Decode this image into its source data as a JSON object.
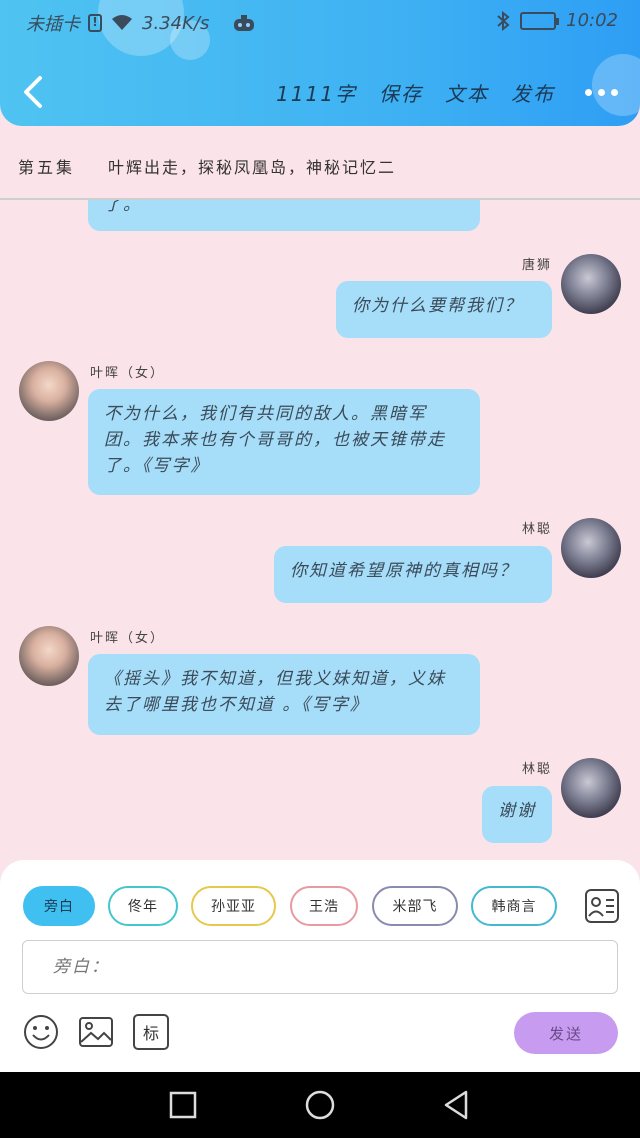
{
  "status_bar": {
    "carrier": "未插卡",
    "sim_badge": "!",
    "speed": "3.34K/s",
    "time": "10:02",
    "icons": [
      "sim-alert-icon",
      "wifi-icon",
      "game-controller-icon",
      "bluetooth-icon",
      "battery-charging-icon"
    ]
  },
  "header": {
    "word_count": "1111字",
    "save_label": "保存",
    "text_label": "文本",
    "publish_label": "发布",
    "accent_color": "#3fb2f3"
  },
  "episode": {
    "number": "第五集",
    "title": "叶辉出走，探秘凤凰岛，神秘记忆二"
  },
  "messages": [
    {
      "side": "left",
      "speaker": "",
      "text": "了。"
    },
    {
      "side": "right",
      "speaker": "唐狮",
      "text": "你为什么要帮我们？"
    },
    {
      "side": "left",
      "speaker": "叶晖（女）",
      "text": "不为什么，我们有共同的敌人。黑暗军团。我本来也有个哥哥的，也被天锥带走了。《写字》"
    },
    {
      "side": "right",
      "speaker": "林聪",
      "text": "你知道希望原神的真相吗？"
    },
    {
      "side": "left",
      "speaker": "叶晖（女）",
      "text": "《摇头》我不知道，但我义妹知道，义妹去了哪里我也不知道 。《写字》"
    },
    {
      "side": "right",
      "speaker": "林聪",
      "text": "谢谢"
    }
  ],
  "characters": [
    {
      "label": "旁白",
      "color": "#3fc0f0"
    },
    {
      "label": "佟年",
      "color": "#43c6cc"
    },
    {
      "label": "孙亚亚",
      "color": "#e6c84a"
    },
    {
      "label": "王浩",
      "color": "#e89aa0"
    },
    {
      "label": "米部飞",
      "color": "#8a8ab0"
    },
    {
      "label": "韩商言",
      "color": "#43b8d0"
    }
  ],
  "input": {
    "placeholder": "旁白："
  },
  "tools": {
    "mark_label": "标",
    "send_label": "发送"
  }
}
